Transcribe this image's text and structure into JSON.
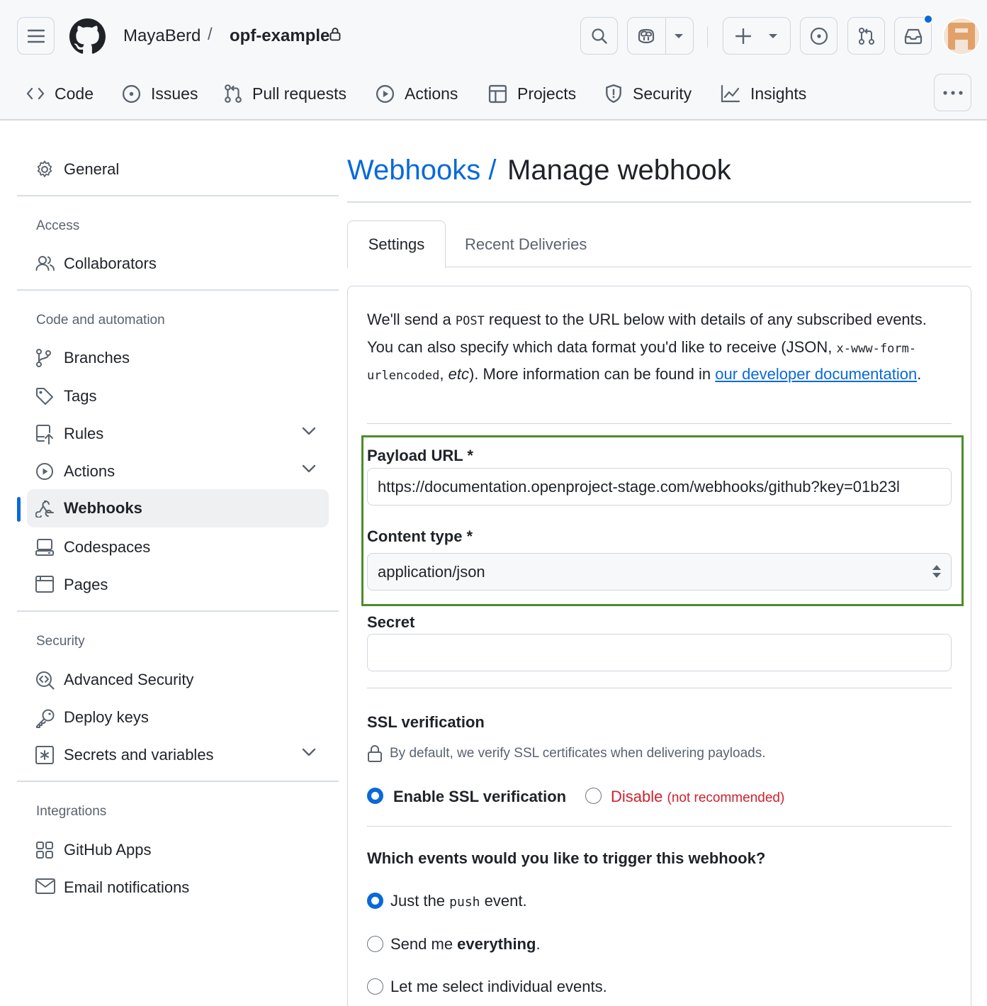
{
  "header": {
    "owner": "MayaBerd",
    "separator": "/",
    "repo": "opf-example"
  },
  "repo_nav": [
    {
      "label": "Code",
      "icon": "code-icon"
    },
    {
      "label": "Issues",
      "icon": "issue-opened-icon"
    },
    {
      "label": "Pull requests",
      "icon": "git-pull-request-icon"
    },
    {
      "label": "Actions",
      "icon": "play-icon"
    },
    {
      "label": "Projects",
      "icon": "table-icon"
    },
    {
      "label": "Security",
      "icon": "shield-icon"
    },
    {
      "label": "Insights",
      "icon": "graph-icon"
    }
  ],
  "sidebar": {
    "general": "General",
    "sections": [
      {
        "heading": "Access",
        "items": [
          "Collaborators"
        ]
      },
      {
        "heading": "Code and automation",
        "items": [
          "Branches",
          "Tags",
          "Rules",
          "Actions",
          "Webhooks",
          "Codespaces",
          "Pages"
        ]
      },
      {
        "heading": "Security",
        "items": [
          "Advanced Security",
          "Deploy keys",
          "Secrets and variables"
        ]
      },
      {
        "heading": "Integrations",
        "items": [
          "GitHub Apps",
          "Email notifications"
        ]
      }
    ],
    "active_item": "Webhooks"
  },
  "page": {
    "breadcrumb_link": "Webhooks /",
    "title": "Manage webhook",
    "tabs": [
      "Settings",
      "Recent Deliveries"
    ],
    "active_tab": "Settings"
  },
  "intro": {
    "t1": "We'll send a ",
    "code1": "POST",
    "t2": " request to the URL below with details of any subscribed events. You can also specify which data format you'd like to receive (JSON, ",
    "code2": "x-www-form-urlencoded",
    "t3": ", ",
    "em": "etc",
    "t4": "). More information can be found in ",
    "link": "our developer documentation",
    "t5": "."
  },
  "form": {
    "payload_label": "Payload URL *",
    "payload_value": "https://documentation.openproject-stage.com/webhooks/github?key=01b23l",
    "content_type_label": "Content type *",
    "content_type_value": "application/json",
    "secret_label": "Secret",
    "secret_value": ""
  },
  "ssl": {
    "heading": "SSL verification",
    "note": "By default, we verify SSL certificates when delivering payloads.",
    "enable_label": "Enable SSL verification",
    "disable_label": "Disable",
    "disable_note": "(not recommended)",
    "selected": "enable"
  },
  "events": {
    "heading": "Which events would you like to trigger this webhook?",
    "option1_pre": "Just the ",
    "option1_code": "push",
    "option1_post": " event.",
    "option2_pre": "Send me ",
    "option2_bold": "everything",
    "option2_post": ".",
    "option3": "Let me select individual events.",
    "selected": "push"
  },
  "colors": {
    "accent": "#0969da",
    "danger": "#cf222e",
    "highlight_border": "#4c8c2b",
    "notification_dot": "#0969da"
  }
}
